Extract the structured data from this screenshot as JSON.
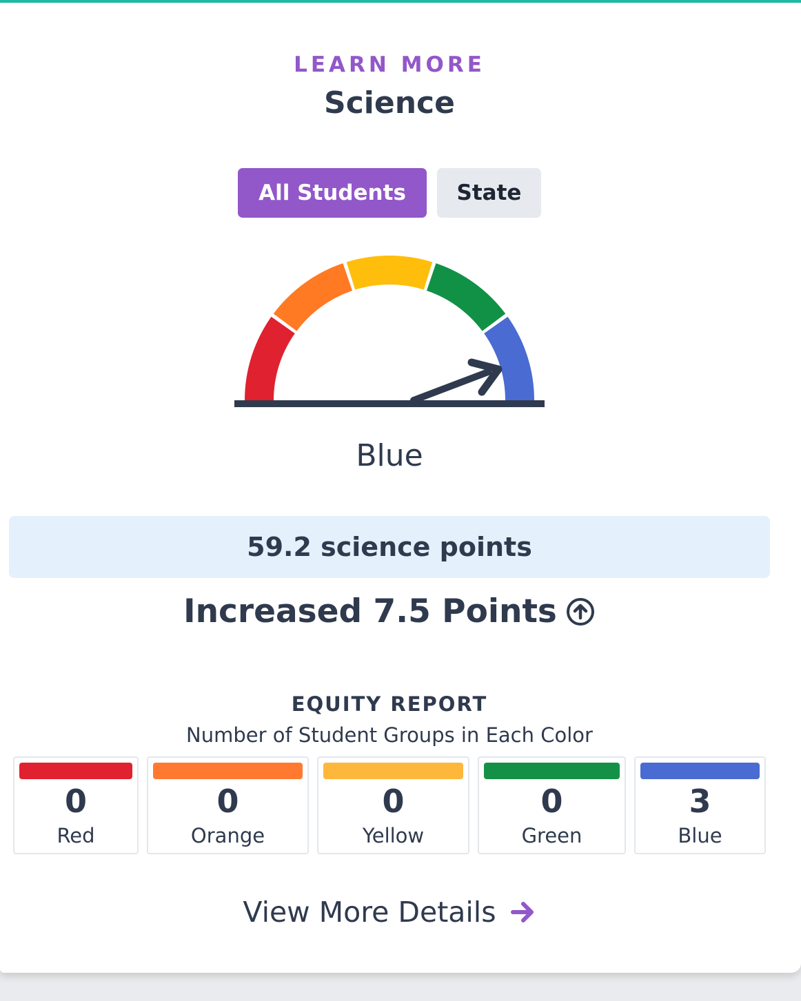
{
  "header": {
    "eyebrow": "LEARN MORE",
    "title": "Science"
  },
  "toggle": {
    "options": [
      {
        "label": "All Students",
        "selected": true
      },
      {
        "label": "State",
        "selected": false
      }
    ]
  },
  "gauge": {
    "label": "Blue",
    "segments": [
      "#e0212f",
      "#ff7a23",
      "#ffbe0b",
      "#119146",
      "#4a6bd1"
    ],
    "needle_color": "#2f3a4e"
  },
  "score": {
    "text": "59.2 science points"
  },
  "change": {
    "text": "Increased 7.5 Points",
    "icon": "arrow-up-circle-icon"
  },
  "equity": {
    "title": "EQUITY REPORT",
    "subtitle": "Number of Student Groups in Each Color",
    "groups": [
      {
        "count": "0",
        "name": "Red",
        "color": "#e0212f"
      },
      {
        "count": "0",
        "name": "Orange",
        "color": "#ff7a30"
      },
      {
        "count": "0",
        "name": "Yellow",
        "color": "#fdb73a"
      },
      {
        "count": "0",
        "name": "Green",
        "color": "#149147"
      },
      {
        "count": "3",
        "name": "Blue",
        "color": "#4a6bd1"
      }
    ]
  },
  "footer": {
    "link_label": "View More Details",
    "link_icon": "arrow-right-icon",
    "link_color": "#9257c9"
  }
}
